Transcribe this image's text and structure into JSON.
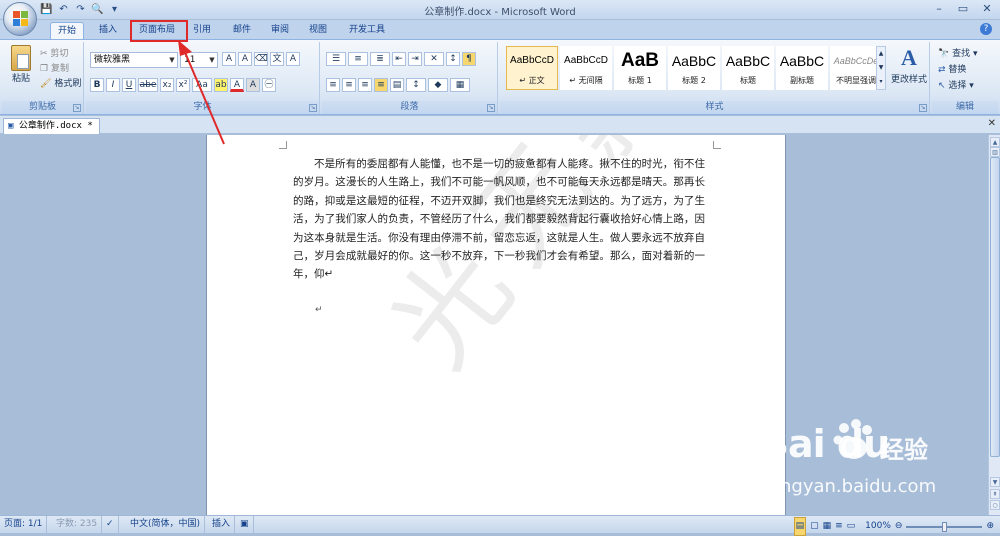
{
  "window": {
    "title": "公章制作.docx - Microsoft Word",
    "controls": [
      "–",
      "▭",
      "✕"
    ]
  },
  "qat": [
    "💾",
    "↶",
    "↷",
    "🔍",
    "▾"
  ],
  "tabs": [
    "开始",
    "插入",
    "页面布局",
    "引用",
    "邮件",
    "审阅",
    "视图",
    "开发工具"
  ],
  "active_tab": "开始",
  "highlighted_tab": "页面布局",
  "clipboard": {
    "paste": "粘贴",
    "cut": "剪切",
    "copy": "复制",
    "format_painter": "格式刷",
    "label": "剪贴板"
  },
  "font": {
    "name": "微软雅黑",
    "size": "11",
    "label": "字体",
    "buttons": [
      "B",
      "I",
      "U",
      "abe",
      "x₂",
      "x²",
      "Aa"
    ]
  },
  "paragraph": {
    "label": "段落"
  },
  "styles": {
    "label": "样式",
    "items": [
      {
        "preview": "AaBbCcD",
        "name": "↵ 正文",
        "selected": true
      },
      {
        "preview": "AaBbCcD",
        "name": "↵ 无间隔"
      },
      {
        "preview": "AaB",
        "name": "标题 1"
      },
      {
        "preview": "AaBbC",
        "name": "标题 2"
      },
      {
        "preview": "AaBbC",
        "name": "标题"
      },
      {
        "preview": "AaBbC",
        "name": "副标题"
      },
      {
        "preview": "AaBbCcDe",
        "name": "不明显强调"
      }
    ],
    "change": "更改样式"
  },
  "editing": {
    "label": "编辑",
    "find": "查找",
    "replace": "替换",
    "select": "选择"
  },
  "document_tab": "公章制作.docx *",
  "document": {
    "paragraph": "不是所有的委屈都有人能懂，也不是一切的疲惫都有人能疼。揪不住的时光，衔不住的岁月。这漫长的人生路上，我们不可能一帆风顺，也不可能每天永远都是晴天。那再长的路，抑或是这最短的征程，不迈开双脚，我们也是终究无法到达的。为了远方，为了生活，为了我们家人的负责，不管经历了什么，我们都要毅然背起行囊收拾好心情上路，因为这本身就是生活。你没有理由停滞不前，留恋忘返，这就是人生。做人要永远不放弃自己，岁月会成就最好的你。这一秒不放弃，下一秒我们才会有希望。那么，面对着新的一年，仰↵",
    "return_mark": "↵",
    "watermark": "光无薪"
  },
  "status": {
    "page": "页面: 1/1",
    "words": "字数: 235",
    "language": "中文(简体，中国)",
    "mode": "插入",
    "zoom": "100%"
  },
  "baidu": {
    "logo": "Bai",
    "logo2": "du",
    "jingyan": "经验",
    "url": "jingyan.baidu.com"
  }
}
